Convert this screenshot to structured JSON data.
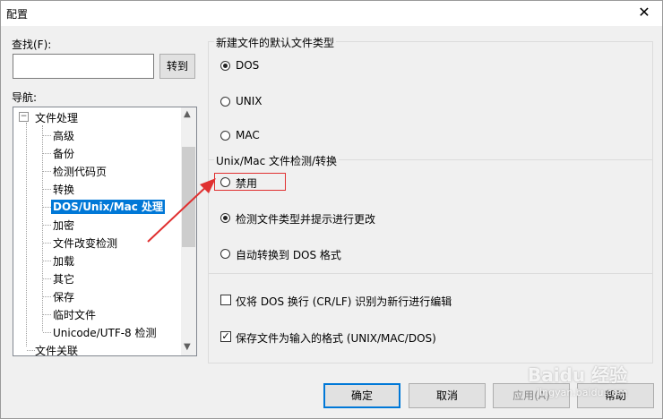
{
  "window": {
    "title": "配置",
    "close_icon": "close-icon"
  },
  "search": {
    "label": "查找(F):",
    "value": "",
    "go_button": "转到"
  },
  "nav": {
    "label": "导航:",
    "root": "文件处理",
    "items": [
      "高级",
      "备份",
      "检测代码页",
      "转换",
      "DOS/Unix/Mac 处理",
      "加密",
      "文件改变检测",
      "加载",
      "其它",
      "保存",
      "临时文件",
      "Unicode/UTF-8 检测"
    ],
    "selected_index": 4,
    "next_root": "文件关联"
  },
  "default_type": {
    "legend": "新建文件的默认文件类型",
    "options": [
      "DOS",
      "UNIX",
      "MAC"
    ],
    "selected": "DOS"
  },
  "detect": {
    "legend": "Unix/Mac 文件检测/转换",
    "options": [
      "禁用",
      "检测文件类型并提示进行更改",
      "自动转换到 DOS 格式"
    ],
    "selected": "检测文件类型并提示进行更改"
  },
  "checks": [
    {
      "label": "仅将 DOS 换行 (CR/LF) 识别为新行进行编辑",
      "checked": false
    },
    {
      "label": "保存文件为输入的格式 (UNIX/MAC/DOS)",
      "checked": true
    }
  ],
  "buttons": {
    "ok": "确定",
    "cancel": "取消",
    "apply": "应用(A)",
    "help": "帮助"
  },
  "watermark": {
    "brand": "Baidu 经验",
    "url": "jingyan.baidu.com"
  },
  "colors": {
    "selection": "#0078d7",
    "annotation": "#e03030"
  }
}
